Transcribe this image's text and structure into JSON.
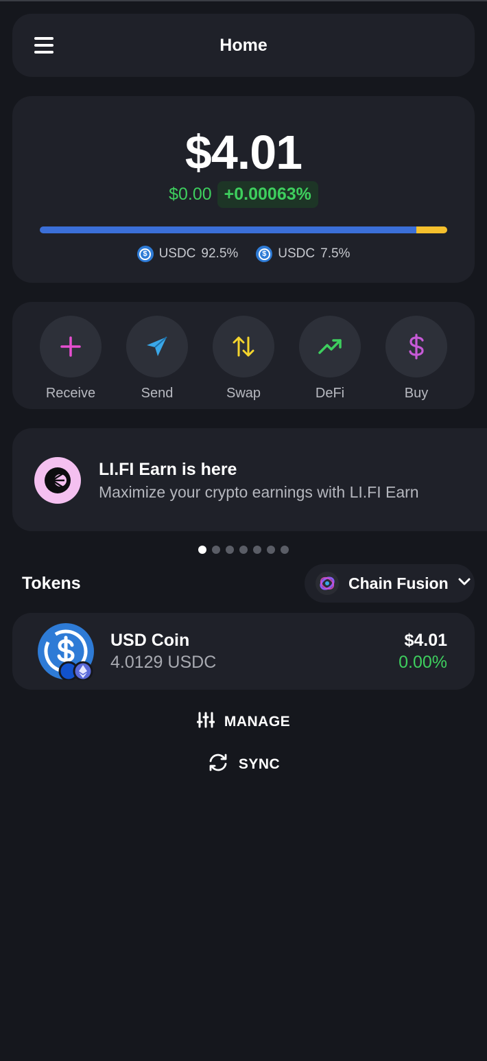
{
  "header": {
    "title": "Home",
    "menu_icon": "hamburger-menu-icon"
  },
  "balance": {
    "total": "$4.01",
    "change_abs": "$0.00",
    "change_pct": "+0.00063%",
    "allocation": [
      {
        "token": "USDC",
        "percent": "92.5%",
        "fraction": 0.925,
        "color": "#3b6fd8"
      },
      {
        "token": "USDC",
        "percent": "7.5%",
        "fraction": 0.075,
        "color": "#f5c02d"
      }
    ]
  },
  "actions": [
    {
      "label": "Receive",
      "icon": "plus-icon",
      "color": "#e64fd0"
    },
    {
      "label": "Send",
      "icon": "paper-plane-icon",
      "color": "#3aa7e8"
    },
    {
      "label": "Swap",
      "icon": "swap-arrows-icon",
      "color": "#f5d52d"
    },
    {
      "label": "DeFi",
      "icon": "trending-up-icon",
      "color": "#3ecf5e"
    },
    {
      "label": "Buy",
      "icon": "dollar-icon",
      "color": "#c65ad6"
    }
  ],
  "promo": {
    "title": "LI.FI Earn is here",
    "subtitle": "Maximize your crypto earnings with LI.FI Earn",
    "icon": "lifi-logo-icon",
    "dots_total": 7,
    "active_dot": 0
  },
  "tokens": {
    "title": "Tokens",
    "network_selector": "Chain Fusion",
    "items": [
      {
        "name": "USD Coin",
        "amount": "4.0129 USDC",
        "value": "$4.01",
        "change": "0.00%",
        "icon": "usdc-icon"
      }
    ]
  },
  "manage_label": "MANAGE",
  "sync_label": "SYNC",
  "colors": {
    "background": "#15171d",
    "card": "#1f2129",
    "positive": "#3ecf5e"
  }
}
